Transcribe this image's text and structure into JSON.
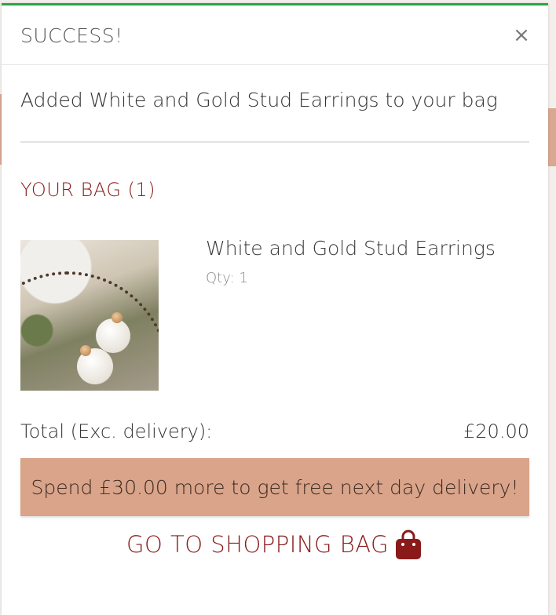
{
  "toast": {
    "title": "SUCCESS!",
    "close_symbol": "×",
    "accent_color": "#27a744"
  },
  "message": "Added White and Gold Stud Earrings to your bag",
  "bag": {
    "heading": "YOUR BAG (1)",
    "items": [
      {
        "name": "White and Gold Stud Earrings",
        "qty_label": "Qty: 1",
        "image_icon": "earrings-product-photo"
      }
    ],
    "total_label": "Total (Exc. delivery):",
    "total_value": "£20.00",
    "delivery_message": "Spend £30.00 more to get free next day delivery!",
    "go_to_bag_label": "GO TO SHOPPING BAG",
    "go_to_bag_icon": "shopping-bag-icon"
  },
  "colors": {
    "heading": "#8a1a1a",
    "banner": "#d9a48a"
  }
}
